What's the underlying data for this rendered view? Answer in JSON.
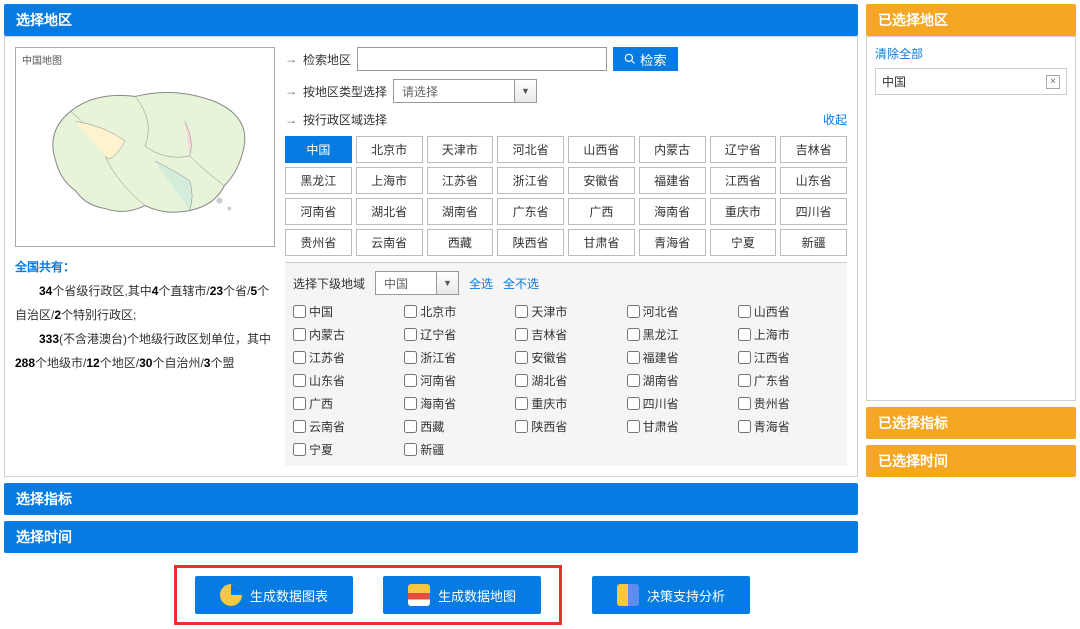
{
  "header": {
    "select_region": "选择地区",
    "selected_region": "已选择地区",
    "select_indicator": "选择指标",
    "selected_indicator": "已选择指标",
    "select_time": "选择时间",
    "selected_time": "已选择时间"
  },
  "search": {
    "label": "检索地区",
    "button": "检索"
  },
  "type_select": {
    "label": "按地区类型选择",
    "placeholder": "请选择"
  },
  "admin_select": {
    "label": "按行政区域选择",
    "collapse": "收起"
  },
  "map": {
    "title": "中国地图"
  },
  "regions": [
    "中国",
    "北京市",
    "天津市",
    "河北省",
    "山西省",
    "内蒙古",
    "辽宁省",
    "吉林省",
    "黑龙江",
    "上海市",
    "江苏省",
    "浙江省",
    "安徽省",
    "福建省",
    "江西省",
    "山东省",
    "河南省",
    "湖北省",
    "湖南省",
    "广东省",
    "广西",
    "海南省",
    "重庆市",
    "四川省",
    "贵州省",
    "云南省",
    "西藏",
    "陕西省",
    "甘肃省",
    "青海省",
    "宁夏",
    "新疆"
  ],
  "active_region_index": 0,
  "sub": {
    "label": "选择下级地域",
    "dropdown": "中国",
    "select_all": "全选",
    "select_none": "全不选",
    "items": [
      "中国",
      "北京市",
      "天津市",
      "河北省",
      "山西省",
      "内蒙古",
      "辽宁省",
      "吉林省",
      "黑龙江",
      "上海市",
      "江苏省",
      "浙江省",
      "安徽省",
      "福建省",
      "江西省",
      "山东省",
      "河南省",
      "湖北省",
      "湖南省",
      "广东省",
      "广西",
      "海南省",
      "重庆市",
      "四川省",
      "贵州省",
      "云南省",
      "西藏",
      "陕西省",
      "甘肃省",
      "青海省",
      "宁夏",
      "新疆"
    ]
  },
  "info": {
    "title": "全国共有：",
    "line1_a": "34",
    "line1_b": "个省级行政区,其中",
    "line1_c": "4",
    "line1_d": "个直辖市/",
    "line1_e": "23",
    "line1_f": "个省/",
    "line1_g": "5",
    "line1_h": "个自治区/",
    "line1_i": "2",
    "line1_j": "个特别行政区;",
    "line2_a": "333",
    "line2_b": "(不含港澳台)个地级行政区划单位，其中",
    "line2_c": "288",
    "line2_d": "个地级市/",
    "line2_e": "12",
    "line2_f": "个地区/",
    "line2_g": "30",
    "line2_h": "个自治州/",
    "line2_i": "3",
    "line2_j": "个盟"
  },
  "side": {
    "clear_all": "清除全部",
    "chip": "中国"
  },
  "buttons": {
    "chart": "生成数据图表",
    "map": "生成数据地图",
    "analysis": "决策支持分析"
  }
}
